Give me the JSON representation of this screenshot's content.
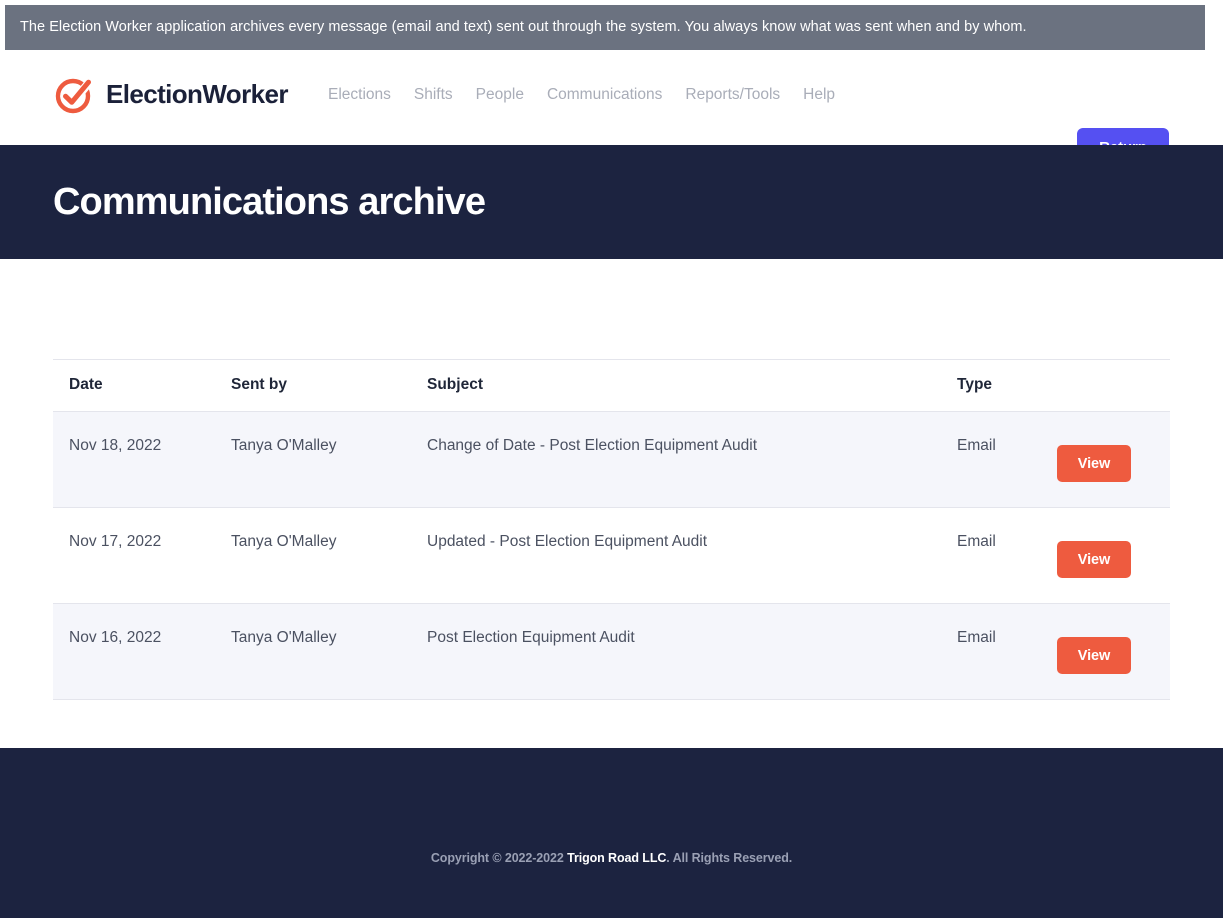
{
  "banner": {
    "text": "The Election Worker application archives every message (email and text) sent out through the system. You always know what was sent when and by whom.",
    "background": "#6b7280"
  },
  "header": {
    "brand_name": "ElectionWorker",
    "brand_icon": "check-circle-icon",
    "brand_color": "#ee5b3f",
    "nav": [
      {
        "label": "Elections"
      },
      {
        "label": "Shifts"
      },
      {
        "label": "People"
      },
      {
        "label": "Communications"
      },
      {
        "label": "Reports/Tools"
      },
      {
        "label": "Help"
      }
    ],
    "return_label": "Return",
    "return_color": "#5550f2"
  },
  "hero": {
    "title": "Communications archive",
    "background": "#1c2340"
  },
  "table": {
    "columns": [
      {
        "label": "Date"
      },
      {
        "label": "Sent by"
      },
      {
        "label": "Subject"
      },
      {
        "label": "Type"
      },
      {
        "label": ""
      }
    ],
    "rows": [
      {
        "date": "Nov 18, 2022",
        "sent_by": "Tanya O'Malley",
        "subject": "Change of Date - Post Election Equipment Audit",
        "type": "Email",
        "action_label": "View"
      },
      {
        "date": "Nov 17, 2022",
        "sent_by": "Tanya O'Malley",
        "subject": "Updated - Post Election Equipment Audit",
        "type": "Email",
        "action_label": "View"
      },
      {
        "date": "Nov 16, 2022",
        "sent_by": "Tanya O'Malley",
        "subject": "Post Election Equipment Audit",
        "type": "Email",
        "action_label": "View"
      }
    ],
    "action_color": "#ee5b3f"
  },
  "footer": {
    "copyright_prefix": "Copyright © 2022-2022 ",
    "company": "Trigon Road LLC",
    "copyright_suffix": ". All Rights Reserved.",
    "background": "#1c2340"
  }
}
